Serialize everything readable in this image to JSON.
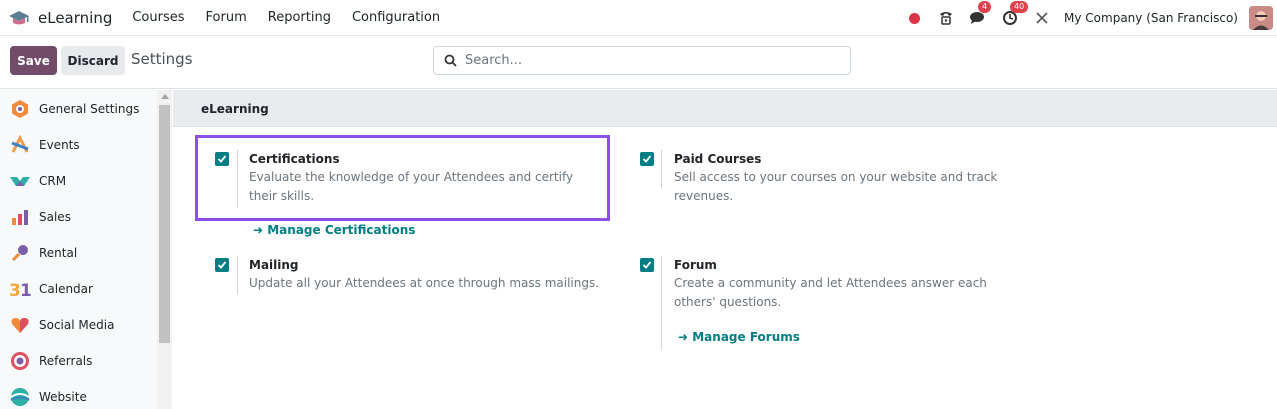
{
  "navbar": {
    "app_name": "eLearning",
    "menu": [
      "Courses",
      "Forum",
      "Reporting",
      "Configuration"
    ],
    "messages_badge": "4",
    "activities_badge": "40",
    "company": "My Company (San Francisco)"
  },
  "control": {
    "save_label": "Save",
    "discard_label": "Discard",
    "title": "Settings",
    "search_placeholder": "Search..."
  },
  "sidebar": {
    "items": [
      {
        "label": "General Settings",
        "icon": "general-settings-icon"
      },
      {
        "label": "Events",
        "icon": "events-icon"
      },
      {
        "label": "CRM",
        "icon": "crm-icon"
      },
      {
        "label": "Sales",
        "icon": "sales-icon"
      },
      {
        "label": "Rental",
        "icon": "rental-icon"
      },
      {
        "label": "Calendar",
        "icon": "calendar-icon"
      },
      {
        "label": "Social Media",
        "icon": "social-media-icon"
      },
      {
        "label": "Referrals",
        "icon": "referrals-icon"
      },
      {
        "label": "Website",
        "icon": "website-icon"
      }
    ]
  },
  "main": {
    "section_title": "eLearning",
    "settings": [
      {
        "title": "Certifications",
        "desc": "Evaluate the knowledge of your Attendees and certify their skills.",
        "checked": true,
        "link": "Manage Certifications"
      },
      {
        "title": "Paid Courses",
        "desc": "Sell access to your courses on your website and track revenues.",
        "checked": true
      },
      {
        "title": "Mailing",
        "desc": "Update all your Attendees at once through mass mailings.",
        "checked": true
      },
      {
        "title": "Forum",
        "desc": "Create a community and let Attendees answer each others' questions.",
        "checked": true,
        "link": "Manage Forums"
      }
    ]
  },
  "colors": {
    "brand": "#714b67",
    "accent": "#017e84",
    "highlight": "#8e4fe6"
  }
}
